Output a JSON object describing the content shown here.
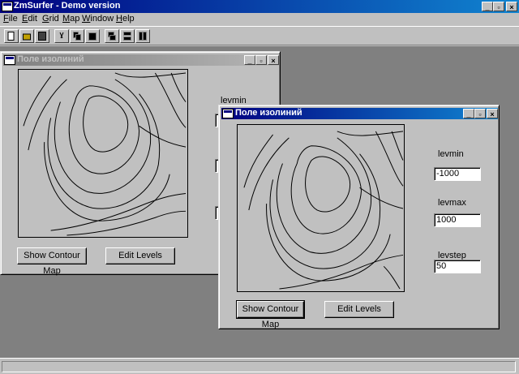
{
  "app": {
    "title": "ZmSurfer - Demo version"
  },
  "menu": [
    "File",
    "Edit",
    "Grid",
    "Map",
    "Window",
    "Help"
  ],
  "window_buttons": {
    "minimize": "_",
    "restore": "▫",
    "close": "×"
  },
  "toolbar": [
    "new-file-icon",
    "open-folder-icon",
    "save-icon",
    "cut-icon",
    "copy-icon",
    "paste-icon",
    "cascade-icon",
    "tile-horizontal-icon",
    "tile-vertical-icon"
  ],
  "back_window": {
    "title": "Поле изолиний",
    "levmin_label": "levmin",
    "show_button": "Show Contour Map",
    "edit_button": "Edit Levels"
  },
  "front_window": {
    "title": "Поле изолиний",
    "levmin_label": "levmin",
    "levmin_value": "-1000",
    "levmax_label": "levmax",
    "levmax_value": "1000",
    "levstep_label": "levstep",
    "levstep_value": "50",
    "show_button": "Show Contour Map",
    "edit_button": "Edit Levels"
  },
  "colors": {
    "titlebar_active": "#000080",
    "titlebar_inactive": "#808080",
    "mdi_background": "#808080",
    "face": "#c0c0c0"
  }
}
